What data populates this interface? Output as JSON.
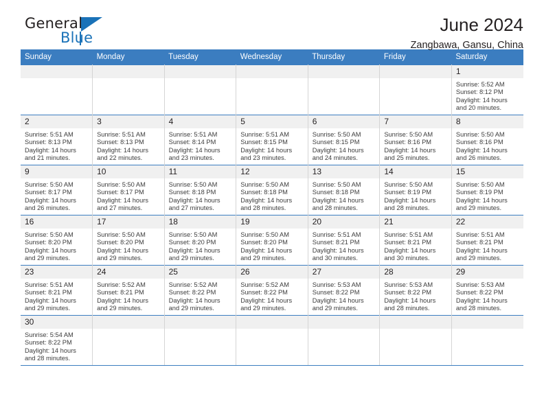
{
  "brand": {
    "name_top": "General",
    "name_bottom": "Blue",
    "accent_color": "#1a72b8"
  },
  "header": {
    "month_title": "June 2024",
    "location": "Zangbawa, Gansu, China"
  },
  "calendar": {
    "header_bg": "#3b7dc0",
    "daynum_bg": "#f0f0f0",
    "weekday_headers": [
      "Sunday",
      "Monday",
      "Tuesday",
      "Wednesday",
      "Thursday",
      "Friday",
      "Saturday"
    ],
    "weeks": [
      [
        {
          "empty": true
        },
        {
          "empty": true
        },
        {
          "empty": true
        },
        {
          "empty": true
        },
        {
          "empty": true
        },
        {
          "empty": true
        },
        {
          "day": "1",
          "sunrise": "Sunrise: 5:52 AM",
          "sunset": "Sunset: 8:12 PM",
          "daylight1": "Daylight: 14 hours",
          "daylight2": "and 20 minutes."
        }
      ],
      [
        {
          "day": "2",
          "sunrise": "Sunrise: 5:51 AM",
          "sunset": "Sunset: 8:13 PM",
          "daylight1": "Daylight: 14 hours",
          "daylight2": "and 21 minutes."
        },
        {
          "day": "3",
          "sunrise": "Sunrise: 5:51 AM",
          "sunset": "Sunset: 8:13 PM",
          "daylight1": "Daylight: 14 hours",
          "daylight2": "and 22 minutes."
        },
        {
          "day": "4",
          "sunrise": "Sunrise: 5:51 AM",
          "sunset": "Sunset: 8:14 PM",
          "daylight1": "Daylight: 14 hours",
          "daylight2": "and 23 minutes."
        },
        {
          "day": "5",
          "sunrise": "Sunrise: 5:51 AM",
          "sunset": "Sunset: 8:15 PM",
          "daylight1": "Daylight: 14 hours",
          "daylight2": "and 23 minutes."
        },
        {
          "day": "6",
          "sunrise": "Sunrise: 5:50 AM",
          "sunset": "Sunset: 8:15 PM",
          "daylight1": "Daylight: 14 hours",
          "daylight2": "and 24 minutes."
        },
        {
          "day": "7",
          "sunrise": "Sunrise: 5:50 AM",
          "sunset": "Sunset: 8:16 PM",
          "daylight1": "Daylight: 14 hours",
          "daylight2": "and 25 minutes."
        },
        {
          "day": "8",
          "sunrise": "Sunrise: 5:50 AM",
          "sunset": "Sunset: 8:16 PM",
          "daylight1": "Daylight: 14 hours",
          "daylight2": "and 26 minutes."
        }
      ],
      [
        {
          "day": "9",
          "sunrise": "Sunrise: 5:50 AM",
          "sunset": "Sunset: 8:17 PM",
          "daylight1": "Daylight: 14 hours",
          "daylight2": "and 26 minutes."
        },
        {
          "day": "10",
          "sunrise": "Sunrise: 5:50 AM",
          "sunset": "Sunset: 8:17 PM",
          "daylight1": "Daylight: 14 hours",
          "daylight2": "and 27 minutes."
        },
        {
          "day": "11",
          "sunrise": "Sunrise: 5:50 AM",
          "sunset": "Sunset: 8:18 PM",
          "daylight1": "Daylight: 14 hours",
          "daylight2": "and 27 minutes."
        },
        {
          "day": "12",
          "sunrise": "Sunrise: 5:50 AM",
          "sunset": "Sunset: 8:18 PM",
          "daylight1": "Daylight: 14 hours",
          "daylight2": "and 28 minutes."
        },
        {
          "day": "13",
          "sunrise": "Sunrise: 5:50 AM",
          "sunset": "Sunset: 8:18 PM",
          "daylight1": "Daylight: 14 hours",
          "daylight2": "and 28 minutes."
        },
        {
          "day": "14",
          "sunrise": "Sunrise: 5:50 AM",
          "sunset": "Sunset: 8:19 PM",
          "daylight1": "Daylight: 14 hours",
          "daylight2": "and 28 minutes."
        },
        {
          "day": "15",
          "sunrise": "Sunrise: 5:50 AM",
          "sunset": "Sunset: 8:19 PM",
          "daylight1": "Daylight: 14 hours",
          "daylight2": "and 29 minutes."
        }
      ],
      [
        {
          "day": "16",
          "sunrise": "Sunrise: 5:50 AM",
          "sunset": "Sunset: 8:20 PM",
          "daylight1": "Daylight: 14 hours",
          "daylight2": "and 29 minutes."
        },
        {
          "day": "17",
          "sunrise": "Sunrise: 5:50 AM",
          "sunset": "Sunset: 8:20 PM",
          "daylight1": "Daylight: 14 hours",
          "daylight2": "and 29 minutes."
        },
        {
          "day": "18",
          "sunrise": "Sunrise: 5:50 AM",
          "sunset": "Sunset: 8:20 PM",
          "daylight1": "Daylight: 14 hours",
          "daylight2": "and 29 minutes."
        },
        {
          "day": "19",
          "sunrise": "Sunrise: 5:50 AM",
          "sunset": "Sunset: 8:20 PM",
          "daylight1": "Daylight: 14 hours",
          "daylight2": "and 29 minutes."
        },
        {
          "day": "20",
          "sunrise": "Sunrise: 5:51 AM",
          "sunset": "Sunset: 8:21 PM",
          "daylight1": "Daylight: 14 hours",
          "daylight2": "and 30 minutes."
        },
        {
          "day": "21",
          "sunrise": "Sunrise: 5:51 AM",
          "sunset": "Sunset: 8:21 PM",
          "daylight1": "Daylight: 14 hours",
          "daylight2": "and 30 minutes."
        },
        {
          "day": "22",
          "sunrise": "Sunrise: 5:51 AM",
          "sunset": "Sunset: 8:21 PM",
          "daylight1": "Daylight: 14 hours",
          "daylight2": "and 29 minutes."
        }
      ],
      [
        {
          "day": "23",
          "sunrise": "Sunrise: 5:51 AM",
          "sunset": "Sunset: 8:21 PM",
          "daylight1": "Daylight: 14 hours",
          "daylight2": "and 29 minutes."
        },
        {
          "day": "24",
          "sunrise": "Sunrise: 5:52 AM",
          "sunset": "Sunset: 8:21 PM",
          "daylight1": "Daylight: 14 hours",
          "daylight2": "and 29 minutes."
        },
        {
          "day": "25",
          "sunrise": "Sunrise: 5:52 AM",
          "sunset": "Sunset: 8:22 PM",
          "daylight1": "Daylight: 14 hours",
          "daylight2": "and 29 minutes."
        },
        {
          "day": "26",
          "sunrise": "Sunrise: 5:52 AM",
          "sunset": "Sunset: 8:22 PM",
          "daylight1": "Daylight: 14 hours",
          "daylight2": "and 29 minutes."
        },
        {
          "day": "27",
          "sunrise": "Sunrise: 5:53 AM",
          "sunset": "Sunset: 8:22 PM",
          "daylight1": "Daylight: 14 hours",
          "daylight2": "and 29 minutes."
        },
        {
          "day": "28",
          "sunrise": "Sunrise: 5:53 AM",
          "sunset": "Sunset: 8:22 PM",
          "daylight1": "Daylight: 14 hours",
          "daylight2": "and 28 minutes."
        },
        {
          "day": "29",
          "sunrise": "Sunrise: 5:53 AM",
          "sunset": "Sunset: 8:22 PM",
          "daylight1": "Daylight: 14 hours",
          "daylight2": "and 28 minutes."
        }
      ],
      [
        {
          "day": "30",
          "sunrise": "Sunrise: 5:54 AM",
          "sunset": "Sunset: 8:22 PM",
          "daylight1": "Daylight: 14 hours",
          "daylight2": "and 28 minutes."
        },
        {
          "empty": true
        },
        {
          "empty": true
        },
        {
          "empty": true
        },
        {
          "empty": true
        },
        {
          "empty": true
        },
        {
          "empty": true
        }
      ]
    ]
  }
}
